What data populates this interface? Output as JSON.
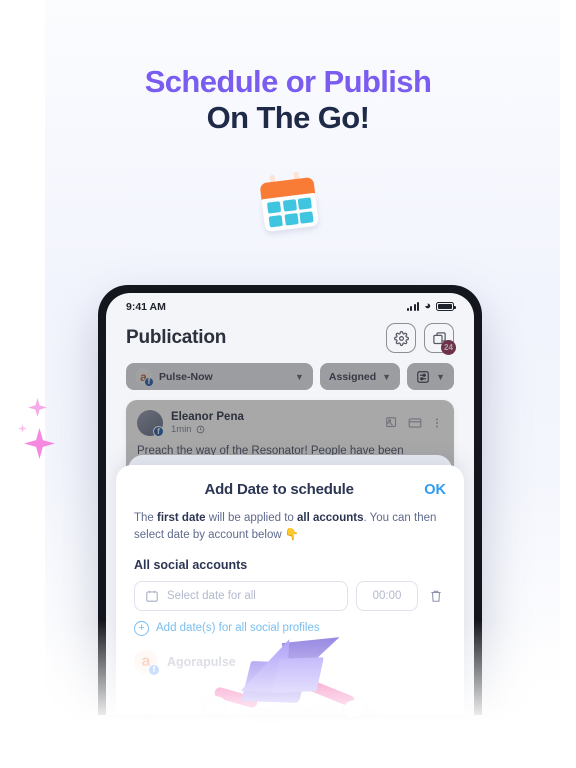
{
  "headline": {
    "line1": "Schedule or Publish",
    "line2": "On The Go!"
  },
  "colors": {
    "accent_purple": "#7b5cf0",
    "headline_dark": "#1e2a47",
    "link_blue": "#2e9bf0",
    "badge_pink": "#e03a7a",
    "calendar_orange": "#f97c36",
    "calendar_cyan": "#3fc5e0",
    "sparkle_pink": "#f589df"
  },
  "decor": {
    "calendar_icon": "calendar-emoji",
    "sparkle_icon": "sparkle-star",
    "plane_illustration": "3d-paper-plane-with-shoes"
  },
  "phone": {
    "statusbar": {
      "time": "9:41 AM",
      "signal_icon": "cellular-signal-icon",
      "wifi_icon": "wifi-icon",
      "battery_icon": "battery-icon"
    },
    "header": {
      "title": "Publication",
      "settings_icon": "gear-icon",
      "inbox_icon": "inbox-icon",
      "inbox_badge": "24"
    },
    "filters": {
      "profile": {
        "name": "Pulse-Now",
        "logo_glyph": "a",
        "network_glyph": "f",
        "chevron_icon": "chevron-down-icon"
      },
      "assigned": {
        "label": "Assigned",
        "chevron_icon": "chevron-down-icon"
      },
      "advanced": {
        "icon": "sliders-filter-icon",
        "chevron_icon": "chevron-down-icon"
      }
    },
    "post": {
      "author": "Eleanor Pena",
      "time": "1min",
      "clock_icon": "clock-icon",
      "network_glyph": "f",
      "text": "Preach the way of the Resonator! People have been sleeping on this effect for way",
      "action_image_icon": "image-icon",
      "action_card_icon": "card-icon",
      "action_more_icon": "more-vertical-icon"
    },
    "modal": {
      "title": "Add Date to schedule",
      "ok_label": "OK",
      "description_part1": "The ",
      "description_bold1": "first date",
      "description_part2": " will be applied to ",
      "description_bold2": "all accounts",
      "description_part3": ". You can then select date by account below ",
      "description_emoji": "👇",
      "section_label": "All social accounts",
      "date_placeholder": "Select date for all",
      "calendar_icon": "calendar-icon",
      "time_value": "00:00",
      "delete_icon": "trash-icon",
      "add_link": "Add date(s) for all social profiles",
      "add_icon": "plus-circle-icon",
      "account": {
        "name": "Agorapulse",
        "logo_glyph": "a",
        "network_glyph": "f"
      }
    }
  }
}
